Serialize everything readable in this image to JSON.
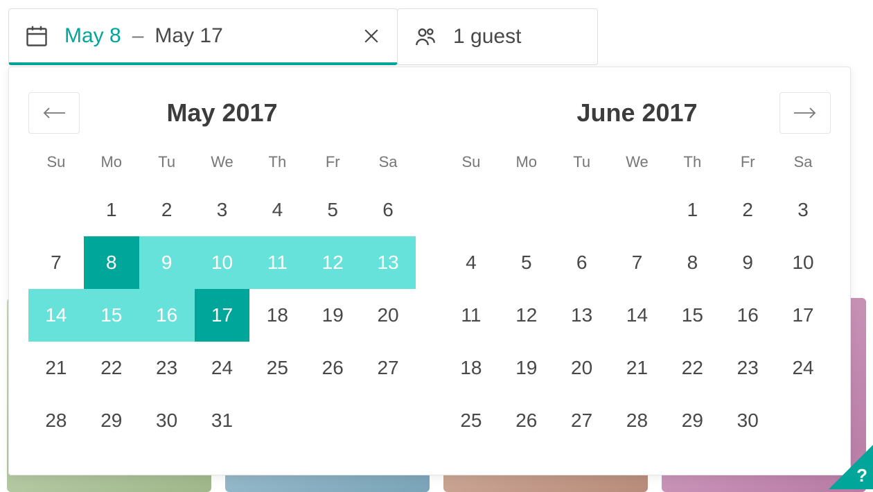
{
  "colors": {
    "accent": "#00a699",
    "range": "#66e2da",
    "text": "#484848",
    "muted": "#767676",
    "border": "#e4e4e4"
  },
  "date_pill": {
    "start": "May 8",
    "sep": "–",
    "end": "May 17"
  },
  "guest_pill": {
    "label": "1 guest"
  },
  "dow": [
    "Su",
    "Mo",
    "Tu",
    "We",
    "Th",
    "Fr",
    "Sa"
  ],
  "months": [
    {
      "title": "May 2017",
      "lead_blanks": 1,
      "days": 31,
      "range": {
        "start": 8,
        "end": 17
      }
    },
    {
      "title": "June 2017",
      "lead_blanks": 4,
      "days": 30,
      "range": null
    }
  ],
  "help": "?"
}
